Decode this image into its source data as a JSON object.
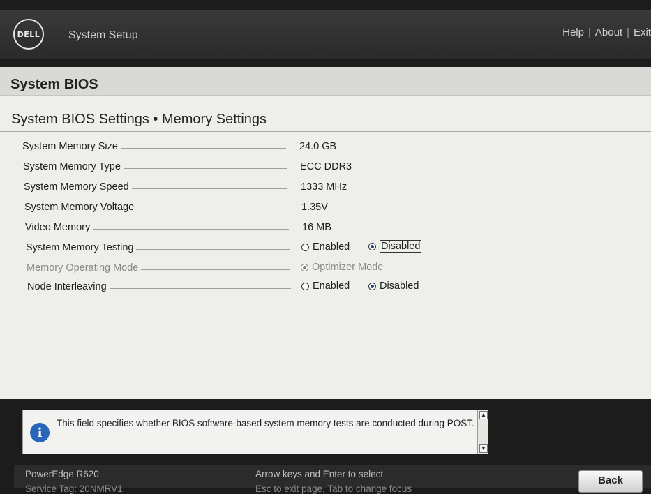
{
  "header": {
    "logo_text": "DELL",
    "app_title": "System Setup",
    "links": [
      "Help",
      "About",
      "Exit"
    ]
  },
  "section": {
    "title": "System BIOS"
  },
  "page": {
    "title": "System BIOS Settings • Memory Settings"
  },
  "settings": [
    {
      "label": "System Memory Size",
      "value": "24.0 GB"
    },
    {
      "label": "System Memory Type",
      "value": "ECC DDR3"
    },
    {
      "label": "System Memory Speed",
      "value": "1333 MHz"
    },
    {
      "label": "System Memory Voltage",
      "value": "1.35V"
    },
    {
      "label": "Video Memory",
      "value": "16 MB"
    },
    {
      "label": "System Memory Testing",
      "options": [
        {
          "label": "Enabled",
          "selected": false
        },
        {
          "label": "Disabled",
          "selected": true
        }
      ]
    },
    {
      "label": "Memory Operating Mode",
      "disabled": true,
      "options": [
        {
          "label": "Optimizer Mode",
          "selected": true
        }
      ]
    },
    {
      "label": "Node Interleaving",
      "options": [
        {
          "label": "Enabled",
          "selected": false
        },
        {
          "label": "Disabled",
          "selected": true
        }
      ]
    }
  ],
  "help": {
    "text": "This field specifies whether BIOS software-based system memory tests are conducted during POST.",
    "icon": "info-icon"
  },
  "footer": {
    "model": "PowerEdge R620",
    "service_tag": "Service Tag: 20NMRV1",
    "hint1": "Arrow keys and Enter to select",
    "hint2": "Esc to exit page, Tab to change focus",
    "back_label": "Back"
  },
  "colors": {
    "accent": "#1e3f8a",
    "header_bg": "#2a2a2a",
    "panel_bg": "#eeeeeb"
  }
}
